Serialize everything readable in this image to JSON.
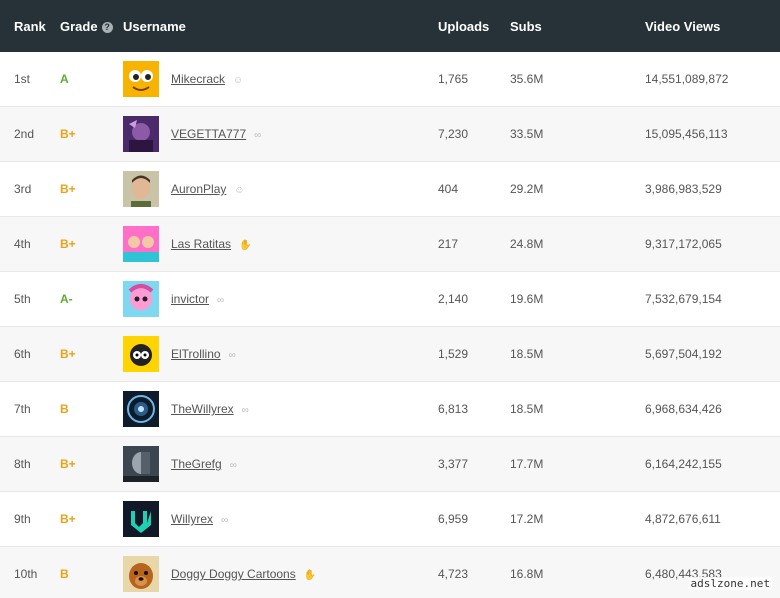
{
  "header": {
    "rank": "Rank",
    "grade": "Grade",
    "help": "?",
    "username": "Username",
    "uploads": "Uploads",
    "subs": "Subs",
    "views": "Video Views"
  },
  "rows": [
    {
      "rank": "1st",
      "grade": "A",
      "grade_color": "#5cae33",
      "username": "Mikecrack",
      "badge": "☺",
      "uploads": "1,765",
      "subs": "35.6M",
      "views": "14,551,089,872",
      "avatar_icon": "yellow-face-avatar"
    },
    {
      "rank": "2nd",
      "grade": "B+",
      "grade_color": "#e8a317",
      "username": "VEGETTA777",
      "badge": "∞",
      "uploads": "7,230",
      "subs": "33.5M",
      "views": "15,095,456,113",
      "avatar_icon": "purple-character-avatar"
    },
    {
      "rank": "3rd",
      "grade": "B+",
      "grade_color": "#e8a317",
      "username": "AuronPlay",
      "badge": "☺",
      "uploads": "404",
      "subs": "29.2M",
      "views": "3,986,983,529",
      "avatar_icon": "man-face-avatar"
    },
    {
      "rank": "4th",
      "grade": "B+",
      "grade_color": "#e8a317",
      "username": "Las Ratitas",
      "badge": "✋",
      "uploads": "217",
      "subs": "24.8M",
      "views": "9,317,172,065",
      "avatar_icon": "pink-kids-avatar"
    },
    {
      "rank": "5th",
      "grade": "A-",
      "grade_color": "#5cae33",
      "username": "invictor",
      "badge": "∞",
      "uploads": "2,140",
      "subs": "19.6M",
      "views": "7,532,679,154",
      "avatar_icon": "pink-anime-avatar"
    },
    {
      "rank": "6th",
      "grade": "B+",
      "grade_color": "#e8a317",
      "username": "ElTrollino",
      "badge": "∞",
      "uploads": "1,529",
      "subs": "18.5M",
      "views": "5,697,504,192",
      "avatar_icon": "cartoon-character-avatar"
    },
    {
      "rank": "7th",
      "grade": "B",
      "grade_color": "#e8a317",
      "username": "TheWillyrex",
      "badge": "∞",
      "uploads": "6,813",
      "subs": "18.5M",
      "views": "6,968,634,426",
      "avatar_icon": "blue-emblem-avatar"
    },
    {
      "rank": "8th",
      "grade": "B+",
      "grade_color": "#e8a317",
      "username": "TheGrefg",
      "badge": "∞",
      "uploads": "3,377",
      "subs": "17.7M",
      "views": "6,164,242,155",
      "avatar_icon": "dark-character-avatar"
    },
    {
      "rank": "9th",
      "grade": "B+",
      "grade_color": "#e8a317",
      "username": "Willyrex",
      "badge": "∞",
      "uploads": "6,959",
      "subs": "17.2M",
      "views": "4,872,676,611",
      "avatar_icon": "teal-logo-avatar"
    },
    {
      "rank": "10th",
      "grade": "B",
      "grade_color": "#e8a317",
      "username": "Doggy Doggy Cartoons",
      "badge": "✋",
      "uploads": "4,723",
      "subs": "16.8M",
      "views": "6,480,443,583",
      "avatar_icon": "dog-avatar"
    }
  ],
  "watermark": "adslzone.net"
}
